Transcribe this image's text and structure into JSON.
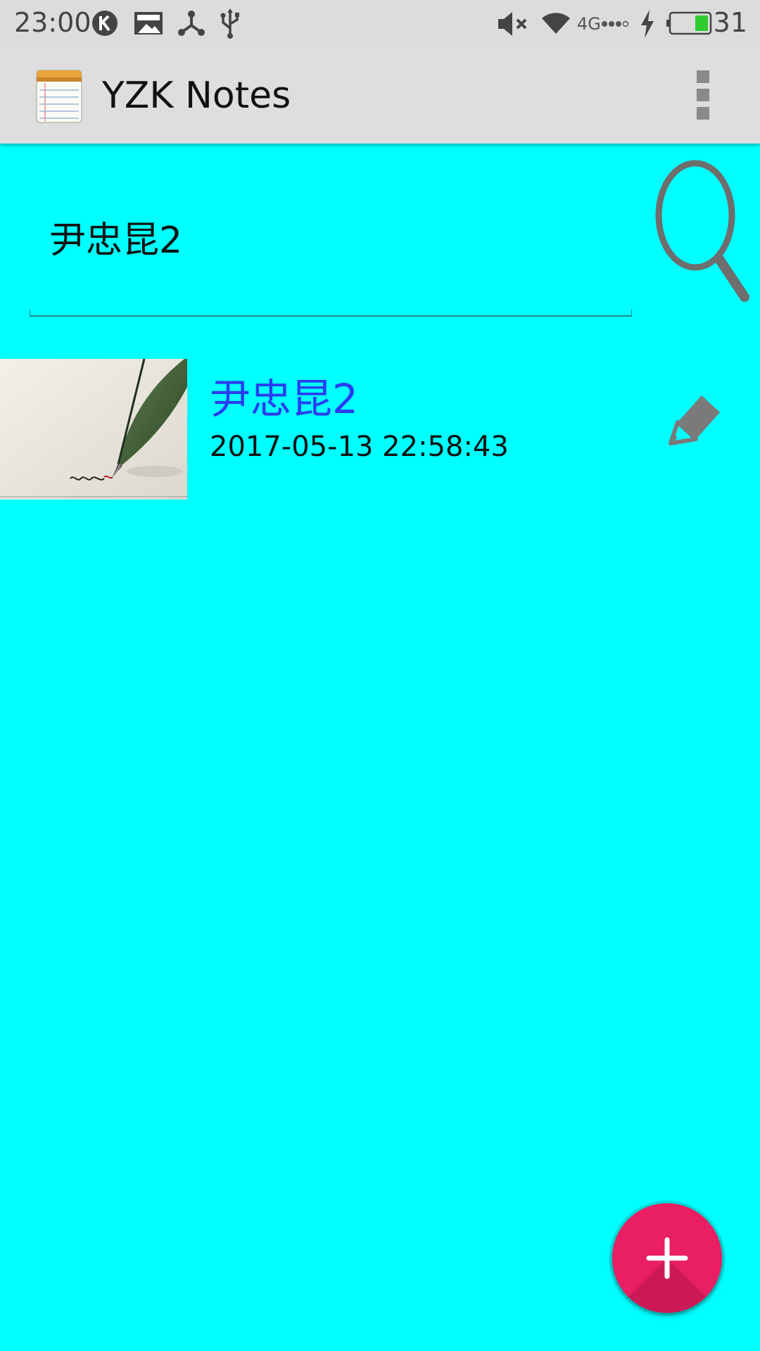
{
  "status_bar": {
    "time": "23:00",
    "network": "4G",
    "battery_percent": "31",
    "icons": [
      "k-app-icon",
      "image-notification-icon",
      "share-network-icon",
      "usb-icon",
      "mute-icon",
      "wifi-icon",
      "signal-icon",
      "charging-icon",
      "battery-icon"
    ]
  },
  "app_bar": {
    "title": "YZK Notes",
    "logo_icon": "notepad-icon",
    "overflow_icon": "more-vert-icon"
  },
  "search": {
    "value": "尹忠昆2",
    "button_icon": "search-icon"
  },
  "notes": [
    {
      "title": "尹忠昆2",
      "datetime": "2017-05-13 22:58:43",
      "thumbnail": "fountain-pen-image",
      "action_icon": "edit-pencil-icon"
    }
  ],
  "fab": {
    "icon": "add-icon"
  },
  "colors": {
    "background": "#00ffff",
    "app_bar": "#dedede",
    "note_title": "#2a3cf0",
    "fab": "#e91e63"
  }
}
